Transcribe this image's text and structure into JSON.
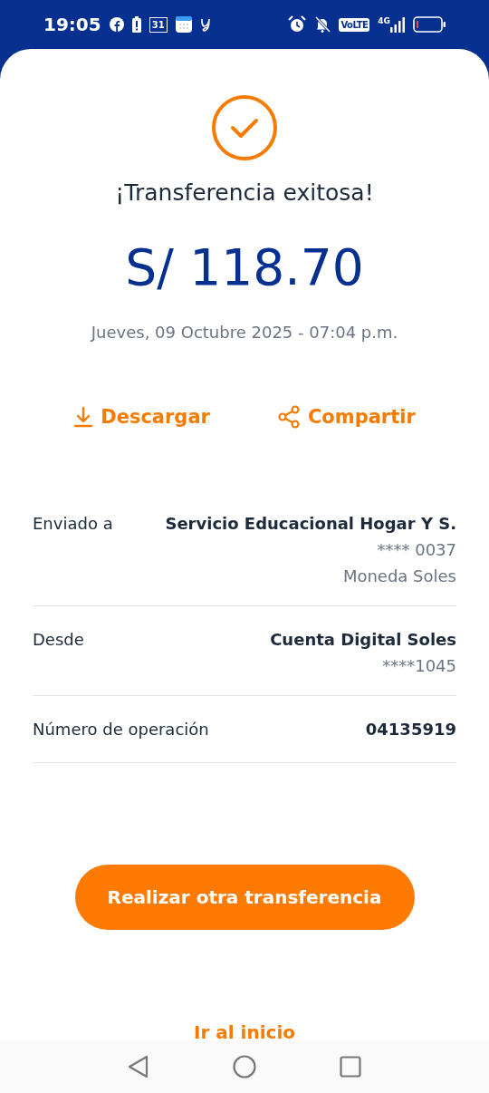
{
  "status_bar": {
    "time": "19:05",
    "calendar_day": "31",
    "volte": "VoLTE",
    "network": "4G"
  },
  "result": {
    "title": "¡Transferencia exitosa!",
    "amount": "S/ 118.70",
    "date": "Jueves, 09 Octubre 2025 - 07:04 p.m."
  },
  "actions": [
    {
      "kind": "download",
      "label": "Descargar"
    },
    {
      "kind": "share",
      "label": "Compartir"
    }
  ],
  "details": [
    {
      "label": "Enviado a",
      "values": [
        "Servicio Educacional Hogar Y S.",
        "**** 0037",
        "Moneda Soles"
      ]
    },
    {
      "label": "Desde",
      "values": [
        "Cuenta Digital Soles",
        "****1045"
      ]
    },
    {
      "label": "Número de operación",
      "values": [
        "04135919"
      ]
    }
  ],
  "primary_button": "Realizar otra transferencia",
  "home_link": "Ir al inicio"
}
